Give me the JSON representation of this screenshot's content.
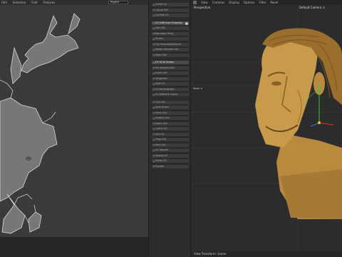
{
  "uv_editor": {
    "menu": [
      "UVs",
      "Selection",
      "Fold",
      "Textures"
    ],
    "mode_select": "Project"
  },
  "tools": {
    "items": [
      "Unfold UV",
      "Layout UVs",
      "Cut/Sew UV",
      "UV UVW from Projection",
      "Sort UVs",
      "Normalize Polys",
      "Fit UVs",
      "Flip Horizontal/Vertical",
      "Rotate Selected UVs",
      "Relax UVs",
      "UV UV to Screen",
      "Pin Selected UVs",
      "Unpin UVs",
      "Straighten",
      "Align UV",
      "UV Rectangulate",
      "UV Optimize Layout",
      "Grid UVs",
      "Shell Orient",
      "Stack UVs",
      "Unstack UVs",
      "Match UVs",
      "Lattice UV",
      "Split UV",
      "Snap UVs",
      "Pack UVs",
      "UV Transfer",
      "Sewing UV",
      "Unfold 3D",
      "Smooth"
    ]
  },
  "viewport": {
    "menu": [
      "View",
      "Cameras",
      "Display",
      "Options",
      "Filter",
      "Panel"
    ],
    "perspective_label": "Perspective",
    "camera_label": "Default Camera ⊙",
    "mid_label": "None ↯",
    "status": "View Transform: Scene"
  }
}
